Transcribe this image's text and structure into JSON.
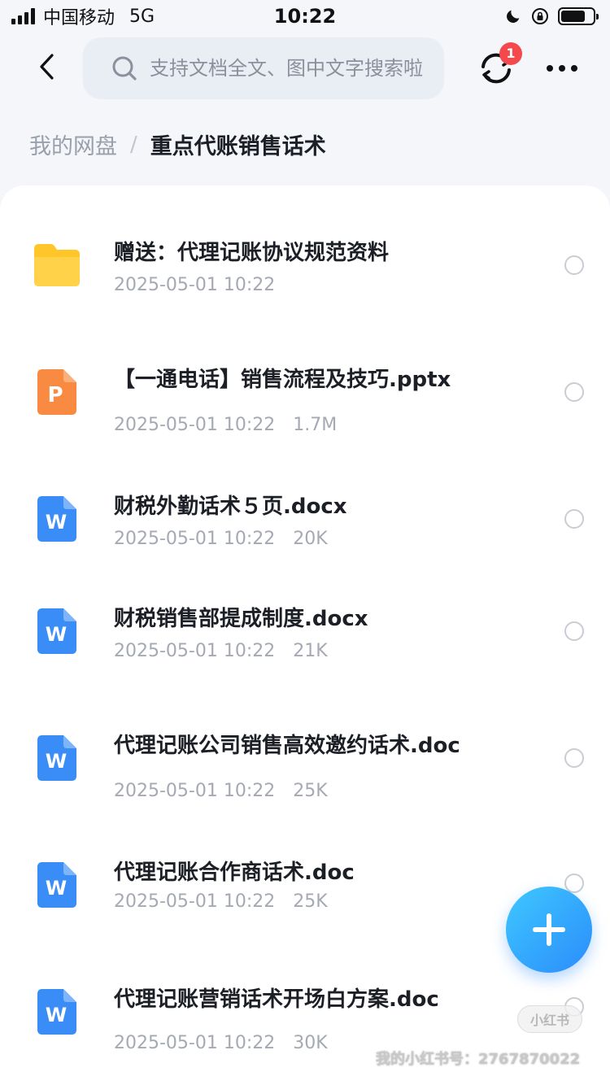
{
  "status_bar": {
    "carrier": "中国移动",
    "network": "5G",
    "time": "10:22"
  },
  "header": {
    "search_placeholder": "支持文档全文、图中文字搜索啦",
    "sync_badge_count": "1"
  },
  "breadcrumb": {
    "root": "我的网盘",
    "separator": "/",
    "current": "重点代账销售话术"
  },
  "files": [
    {
      "name": "赠送：代理记账协议规范资料",
      "date": "2025-05-01 10:22",
      "size": "",
      "type": "folder"
    },
    {
      "name": "【一通电话】销售流程及技巧.pptx",
      "date": "2025-05-01 10:22",
      "size": "1.7M",
      "type": "pptx"
    },
    {
      "name": "财税外勤话术５页.docx",
      "date": "2025-05-01 10:22",
      "size": "20K",
      "type": "doc"
    },
    {
      "name": "财税销售部提成制度.docx",
      "date": "2025-05-01 10:22",
      "size": "21K",
      "type": "doc"
    },
    {
      "name": "代理记账公司销售高效邀约话术.doc",
      "date": "2025-05-01 10:22",
      "size": "25K",
      "type": "doc"
    },
    {
      "name": "代理记账合作商话术.doc",
      "date": "2025-05-01 10:22",
      "size": "25K",
      "type": "doc"
    },
    {
      "name": "代理记账营销话术开场白方案.doc",
      "date": "2025-05-01 10:22",
      "size": "30K",
      "type": "doc"
    }
  ],
  "icons": {
    "folder_color": "#ffc629",
    "pptx_color": "#f98a42",
    "doc_color": "#3a8cf6",
    "pptx_letter": "P",
    "doc_letter": "W"
  },
  "watermark": {
    "logo": "小红书",
    "text": "我的小红书号：2767870022"
  }
}
